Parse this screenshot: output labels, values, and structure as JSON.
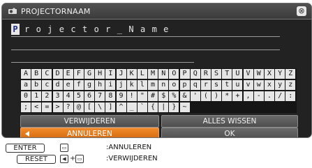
{
  "window": {
    "title": "PROJECTORNAAM"
  },
  "name_field": {
    "value": "Projector_Name",
    "cursor_char": "P"
  },
  "keyboard": {
    "rows": [
      [
        "A",
        "B",
        "C",
        "D",
        "E",
        "F",
        "G",
        "H",
        "I",
        "J",
        "K",
        "L",
        "M",
        "N",
        "O",
        "P",
        "Q",
        "R",
        "S",
        "T",
        "U",
        "V",
        "W",
        "X",
        "Y",
        "Z"
      ],
      [
        "a",
        "b",
        "c",
        "d",
        "e",
        "f",
        "g",
        "h",
        "i",
        "j",
        "k",
        "l",
        "m",
        "n",
        "o",
        "p",
        "q",
        "r",
        "s",
        "t",
        "u",
        "v",
        "w",
        "x",
        "y",
        "z"
      ],
      [
        "0",
        "1",
        "2",
        "3",
        "4",
        "5",
        "6",
        "7",
        "8",
        "9",
        "!",
        "\"",
        "#",
        "$",
        "%",
        "&",
        "'",
        "(",
        ")",
        "*",
        "+",
        ",",
        "-",
        ".",
        "/",
        ":"
      ],
      [
        ";",
        "<",
        "=",
        ">",
        "?",
        "@",
        "[",
        "\\",
        "]",
        "^",
        "_",
        "`",
        "{",
        "|",
        "}",
        "~"
      ]
    ]
  },
  "buttons": {
    "delete": "VERWIJDEREN",
    "clear_all": "ALLES WISSEN",
    "cancel": "ANNULEREN",
    "ok": "OK"
  },
  "hints": [
    {
      "key": "ENTER",
      "extra": "",
      "action": ":ANNULEREN"
    },
    {
      "key": "RESET",
      "extra": "+",
      "action": ":VERWIJDEREN"
    }
  ],
  "colors": {
    "window_bg": "#232223",
    "accent_orange": "#e67a1e",
    "key_bg": "#e6e6e6"
  }
}
